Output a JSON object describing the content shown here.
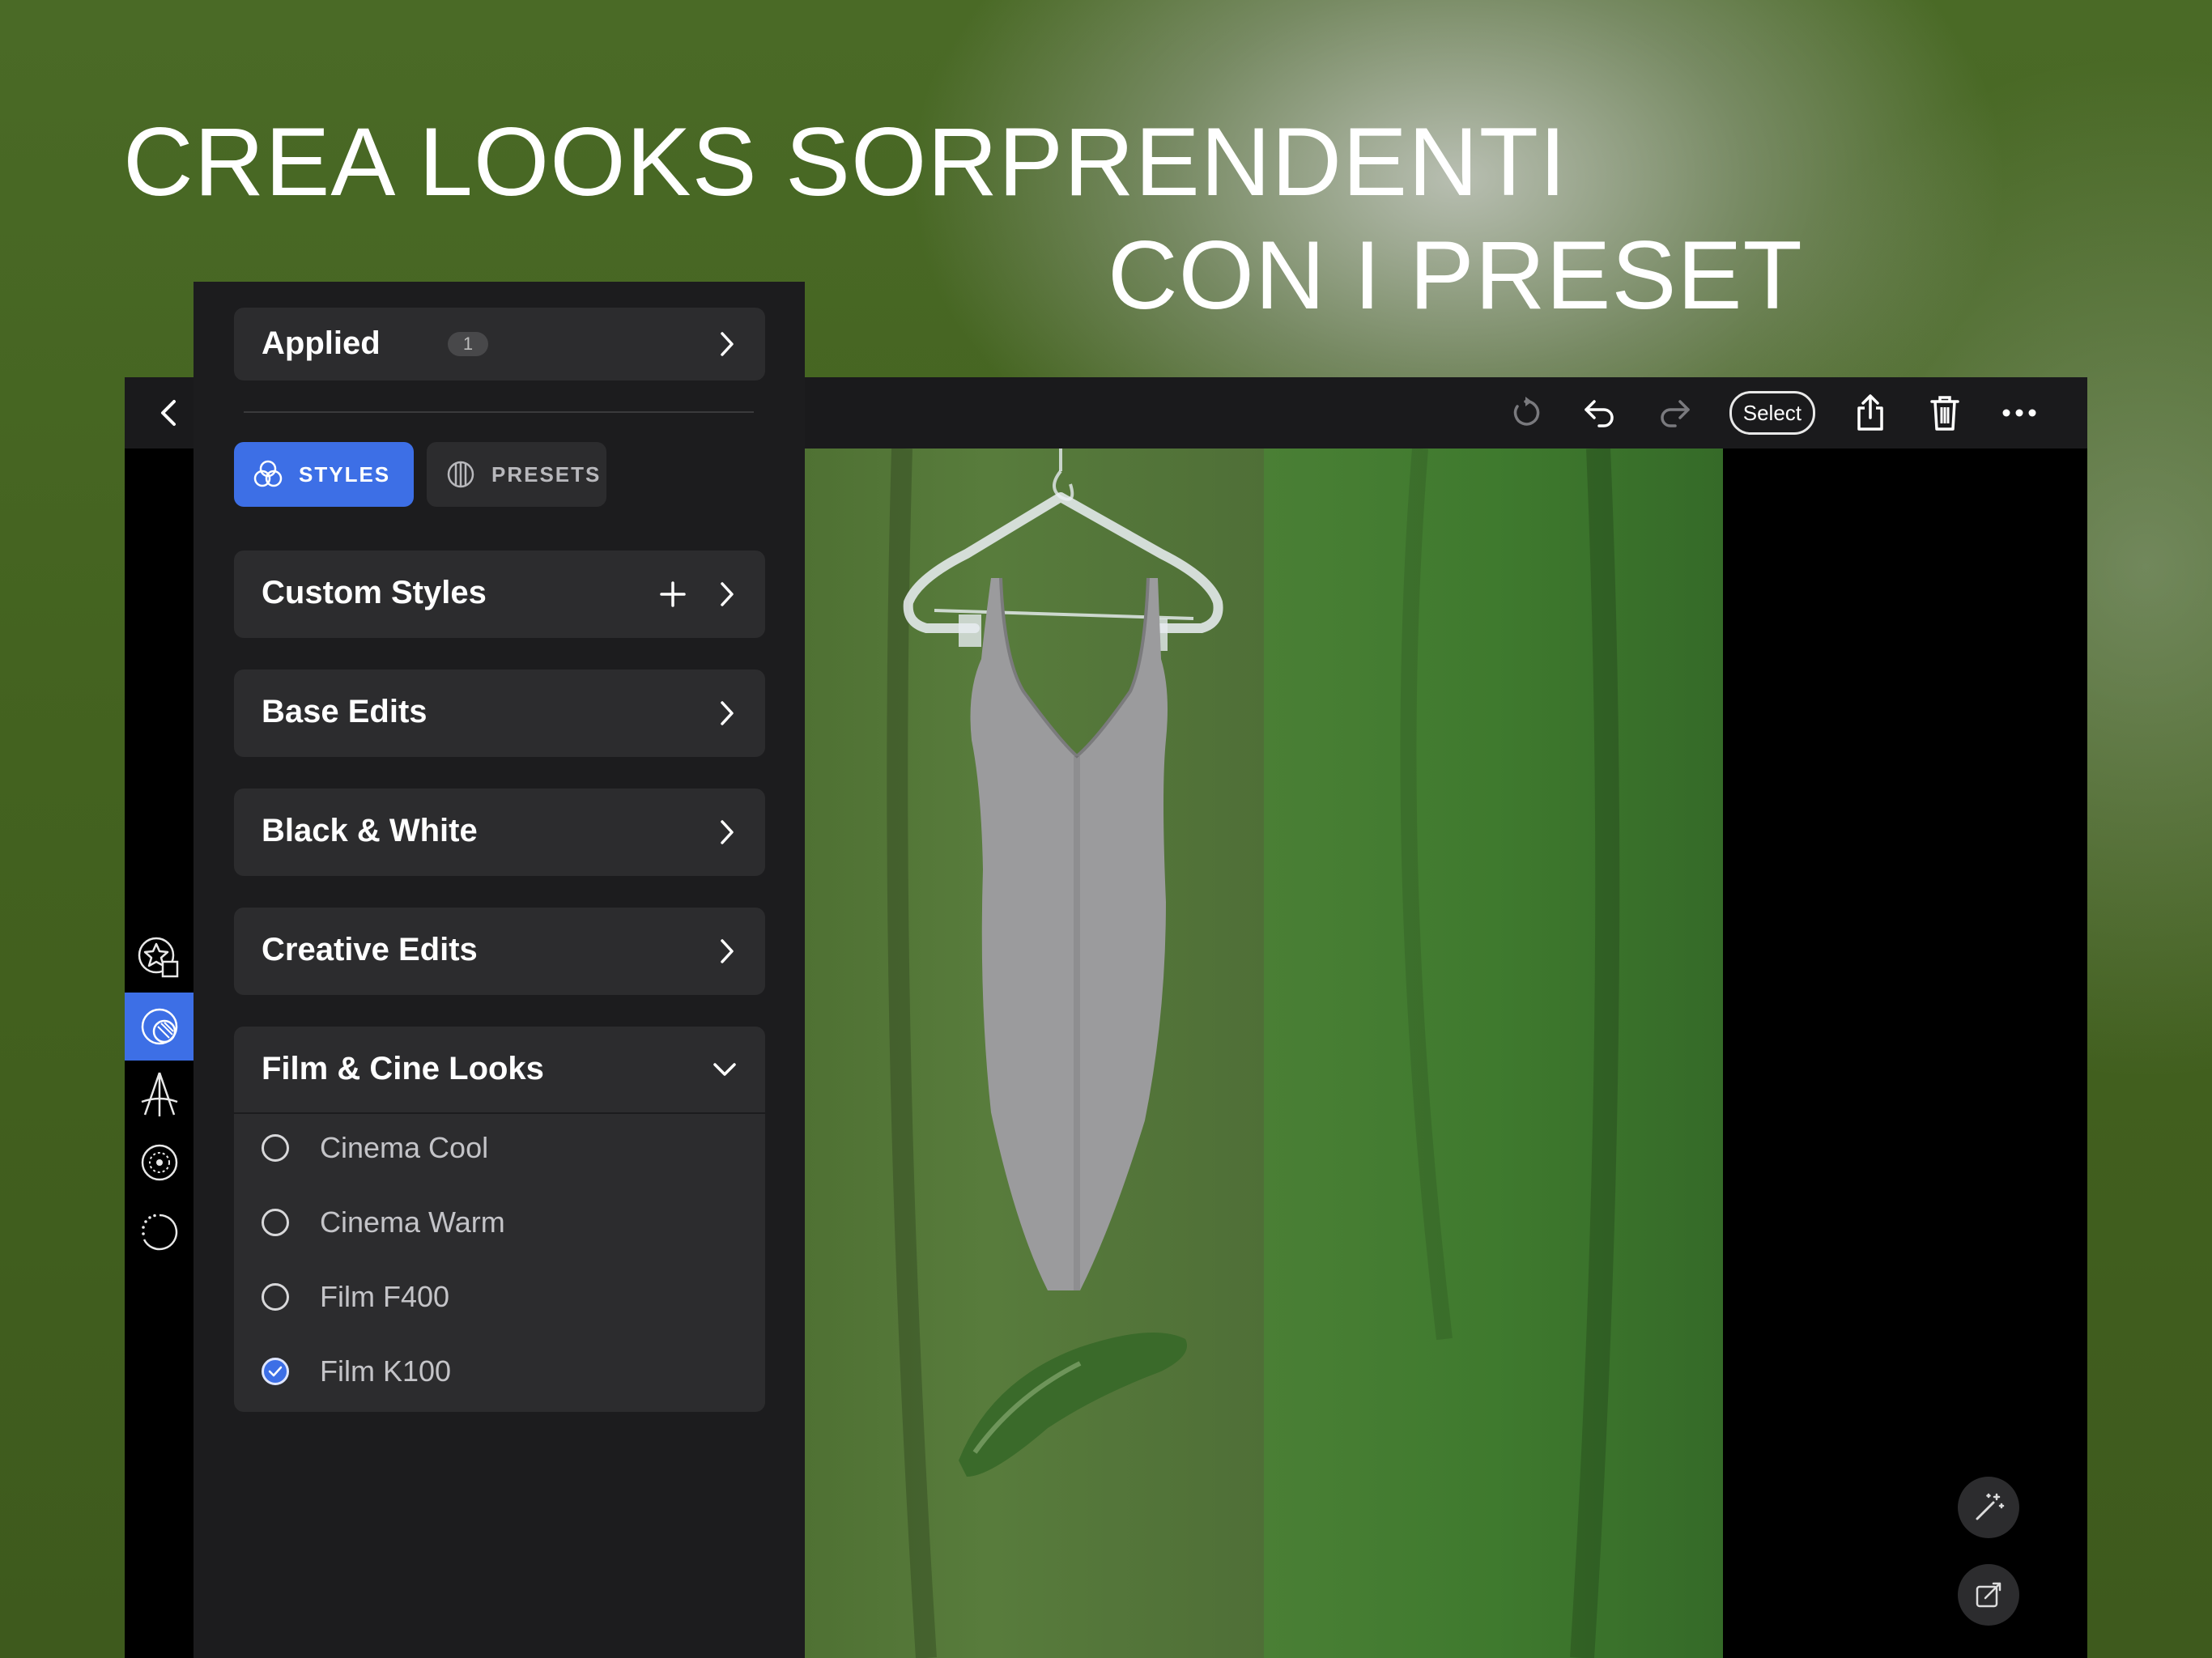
{
  "headline": {
    "line1": "CREA LOOKS SORPRENDENTI",
    "line2": "CON I PRESET"
  },
  "toolbar": {
    "select_label": "Select",
    "icons": [
      "back-chevron-icon",
      "revert-icon",
      "undo-icon",
      "redo-icon",
      "share-icon",
      "trash-icon",
      "more-icon"
    ]
  },
  "rail": {
    "icons": [
      "star-shapes-icon",
      "styles-icon",
      "perspective-icon",
      "lens-icon",
      "dotted-circle-icon"
    ],
    "active_index": 1
  },
  "panel": {
    "applied": {
      "label": "Applied",
      "count": "1"
    },
    "tabs": [
      {
        "label": "STYLES",
        "active": true
      },
      {
        "label": "PRESETS",
        "active": false
      }
    ],
    "groups": [
      {
        "label": "Custom Styles"
      },
      {
        "label": "Base Edits"
      },
      {
        "label": "Black & White"
      },
      {
        "label": "Creative Edits"
      },
      {
        "label": "Film & Cine Looks",
        "expanded": true
      }
    ],
    "presets": [
      {
        "label": "Cinema Cool",
        "checked": false
      },
      {
        "label": "Cinema Warm",
        "checked": false
      },
      {
        "label": "Film F400",
        "checked": false
      },
      {
        "label": "Film K100",
        "checked": true
      }
    ]
  },
  "colors": {
    "accent": "#3d6fe6",
    "panel_bg": "#1c1c1e",
    "card_bg": "#2c2c2e"
  }
}
